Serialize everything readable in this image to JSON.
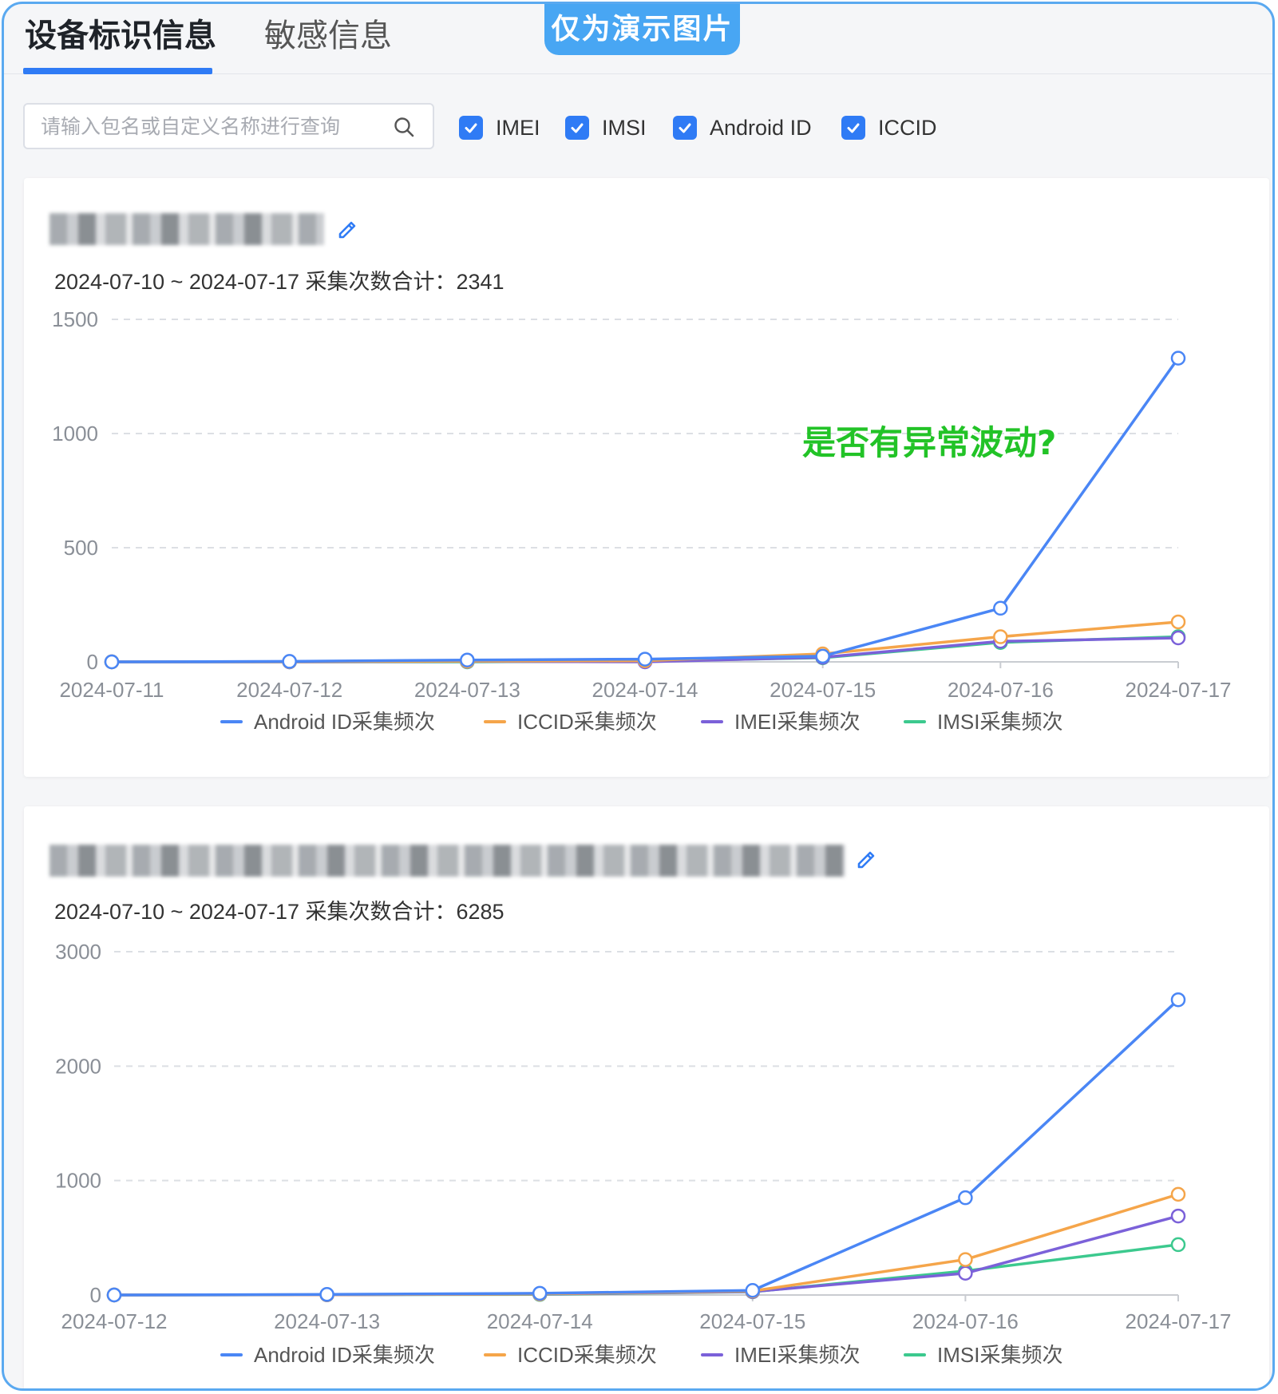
{
  "tabs": [
    {
      "label": "设备标识信息",
      "active": true
    },
    {
      "label": "敏感信息",
      "active": false
    }
  ],
  "demo_badge": "仅为演示图片",
  "search": {
    "placeholder": "请输入包名或自定义名称进行查询",
    "value": ""
  },
  "filters": [
    {
      "label": "IMEI",
      "checked": true
    },
    {
      "label": "IMSI",
      "checked": true
    },
    {
      "label": "Android ID",
      "checked": true
    },
    {
      "label": "ICCID",
      "checked": true
    }
  ],
  "colors": {
    "accent": "#2f7bf5",
    "android_id": "#4a86f5",
    "iccid": "#f5a54a",
    "imei": "#7b61d9",
    "imsi": "#3cc98e",
    "annotation": "#22c327"
  },
  "cards": [
    {
      "summary": "2024-07-10 ~ 2024-07-17 采集次数合计：2341",
      "annotation": "是否有异常波动?"
    },
    {
      "summary": "2024-07-10 ~ 2024-07-17 采集次数合计：6285"
    }
  ],
  "chart_data": [
    {
      "type": "line",
      "x": [
        "2024-07-11",
        "2024-07-12",
        "2024-07-13",
        "2024-07-14",
        "2024-07-15",
        "2024-07-16",
        "2024-07-17"
      ],
      "ylim": [
        0,
        1500
      ],
      "yticks": [
        0,
        500,
        1000,
        1500
      ],
      "grid": true,
      "legend_position": "bottom",
      "series": [
        {
          "name": "Android ID采集频次",
          "color": "#4a86f5",
          "values": [
            0,
            2,
            8,
            12,
            25,
            235,
            1330
          ]
        },
        {
          "name": "ICCID采集频次",
          "color": "#f5a54a",
          "values": [
            0,
            1,
            3,
            5,
            35,
            110,
            175
          ]
        },
        {
          "name": "IMEI采集频次",
          "color": "#7b61d9",
          "values": [
            0,
            0,
            2,
            0,
            20,
            90,
            105
          ]
        },
        {
          "name": "IMSI采集频次",
          "color": "#3cc98e",
          "values": [
            0,
            0,
            0,
            3,
            18,
            85,
            110
          ]
        }
      ]
    },
    {
      "type": "line",
      "x": [
        "2024-07-12",
        "2024-07-13",
        "2024-07-14",
        "2024-07-15",
        "2024-07-16",
        "2024-07-17"
      ],
      "ylim": [
        0,
        3000
      ],
      "yticks": [
        0,
        1000,
        2000,
        3000
      ],
      "grid": true,
      "legend_position": "bottom",
      "series": [
        {
          "name": "Android ID采集频次",
          "color": "#4a86f5",
          "values": [
            0,
            5,
            15,
            40,
            850,
            2580
          ]
        },
        {
          "name": "ICCID采集频次",
          "color": "#f5a54a",
          "values": [
            0,
            3,
            10,
            35,
            310,
            880
          ]
        },
        {
          "name": "IMEI采集频次",
          "color": "#7b61d9",
          "values": [
            0,
            2,
            8,
            30,
            190,
            690
          ]
        },
        {
          "name": "IMSI采集频次",
          "color": "#3cc98e",
          "values": [
            0,
            2,
            5,
            28,
            210,
            440
          ]
        }
      ]
    }
  ]
}
